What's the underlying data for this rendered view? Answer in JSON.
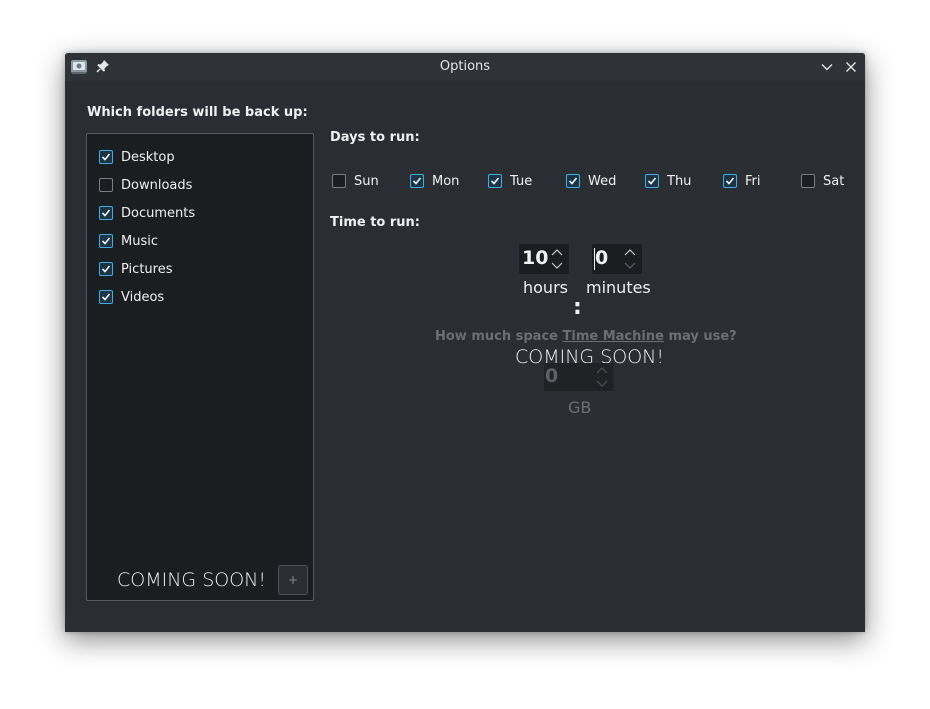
{
  "window": {
    "title": "Options"
  },
  "folders": {
    "heading": "Which folders will be back up:",
    "items": [
      {
        "label": "Desktop",
        "checked": true
      },
      {
        "label": "Downloads",
        "checked": false
      },
      {
        "label": "Documents",
        "checked": true
      },
      {
        "label": "Music",
        "checked": true
      },
      {
        "label": "Pictures",
        "checked": true
      },
      {
        "label": "Videos",
        "checked": true
      }
    ],
    "coming_soon": "COMING SOON!",
    "add_button": "+"
  },
  "days": {
    "heading": "Days to run:",
    "items": [
      {
        "label": "Sun",
        "checked": false
      },
      {
        "label": "Mon",
        "checked": true
      },
      {
        "label": "Tue",
        "checked": true
      },
      {
        "label": "Wed",
        "checked": true
      },
      {
        "label": "Thu",
        "checked": true
      },
      {
        "label": "Fri",
        "checked": true
      },
      {
        "label": "Sat",
        "checked": false
      }
    ]
  },
  "time": {
    "heading": "Time to run:",
    "hours_value": "10",
    "minutes_value": "0",
    "separator": ":",
    "hours_label": "hours",
    "minutes_label": "minutes"
  },
  "space": {
    "question_prefix": "How much space ",
    "question_link": "Time Machine",
    "question_suffix": " may use?",
    "coming_soon": "COMING SOON!",
    "value": "0",
    "unit": "GB"
  },
  "colors": {
    "accent": "#3daee9",
    "background": "#2a2e32",
    "panel": "#1b1e21"
  }
}
